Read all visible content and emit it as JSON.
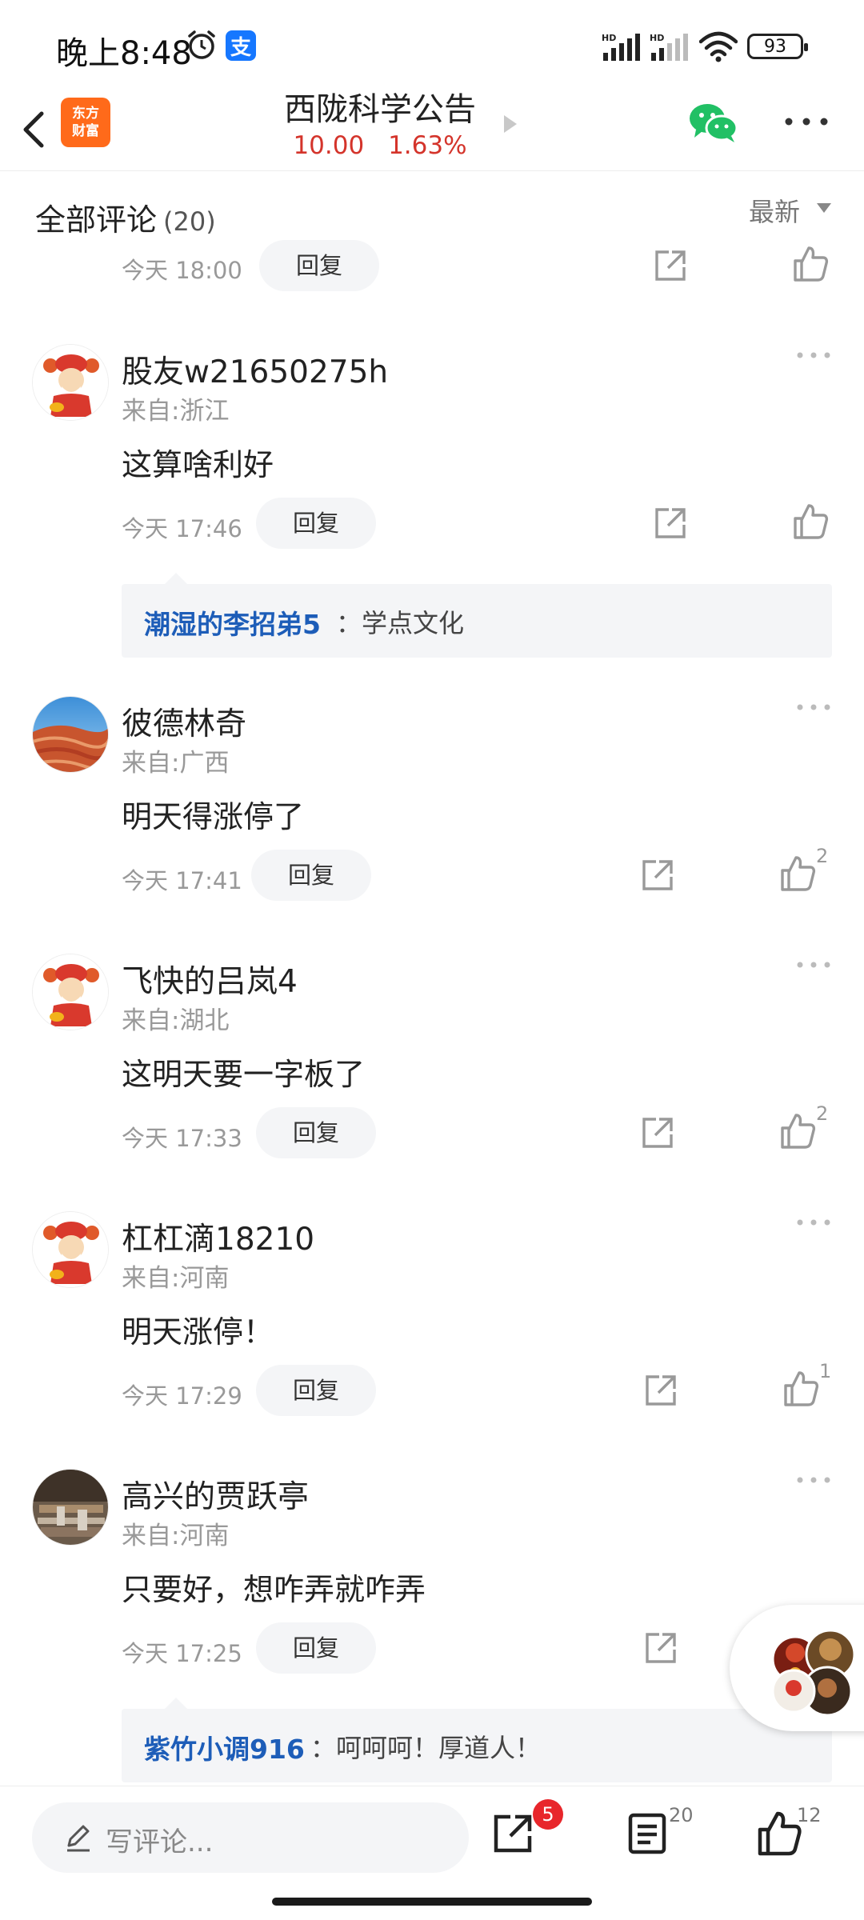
{
  "status_bar": {
    "time": "晚上8:48",
    "alipay_glyph": "支",
    "battery": "93",
    "icons": [
      "alarm-icon",
      "alipay-icon",
      "signal-hd-icon",
      "signal-hd-icon",
      "wifi-icon",
      "battery-icon"
    ]
  },
  "header": {
    "logo_line1": "东方",
    "logo_line2": "财富",
    "title": "西陇科学公告",
    "price": "10.00",
    "change": "1.63%",
    "colors": {
      "logo": "#ff6a1a",
      "quote": "#d4342b",
      "wechat": "#21c065"
    }
  },
  "section": {
    "title": "全部评论",
    "count": "(20)",
    "sort_label": "最新"
  },
  "comments": [
    {
      "username": "",
      "location": "",
      "text": "",
      "time": "今天 18:00",
      "reply_label": "回复",
      "likes": ""
    },
    {
      "username": "股友w21650275h",
      "location": "来自:浙江",
      "text": "这算啥利好",
      "time": "今天 17:46",
      "reply_label": "回复",
      "likes": "",
      "sub_reply": {
        "user": "潮湿的李招弟5",
        "text": "：学点文化"
      }
    },
    {
      "username": "彼德林奇",
      "location": "来自:广西",
      "text": "明天得涨停了",
      "time": "今天 17:41",
      "reply_label": "回复",
      "likes": "2"
    },
    {
      "username": "飞快的吕岚4",
      "location": "来自:湖北",
      "text": "这明天要一字板了",
      "time": "今天 17:33",
      "reply_label": "回复",
      "likes": "2"
    },
    {
      "username": "杠杠滴18210",
      "location": "来自:河南",
      "text": "明天涨停！",
      "time": "今天 17:29",
      "reply_label": "回复",
      "likes": "1"
    },
    {
      "username": "高兴的贾跃亭",
      "location": "来自:河南",
      "text": "只要好，想咋弄就咋弄",
      "time": "今天 17:25",
      "reply_label": "回复",
      "likes": "",
      "sub_reply": {
        "user": "紫竹小调916",
        "text": "：呵呵呵！厚道人！"
      }
    }
  ],
  "bottom_bar": {
    "input_placeholder": "写评论...",
    "share_badge": "5",
    "comment_count": "20",
    "like_count": "12"
  }
}
